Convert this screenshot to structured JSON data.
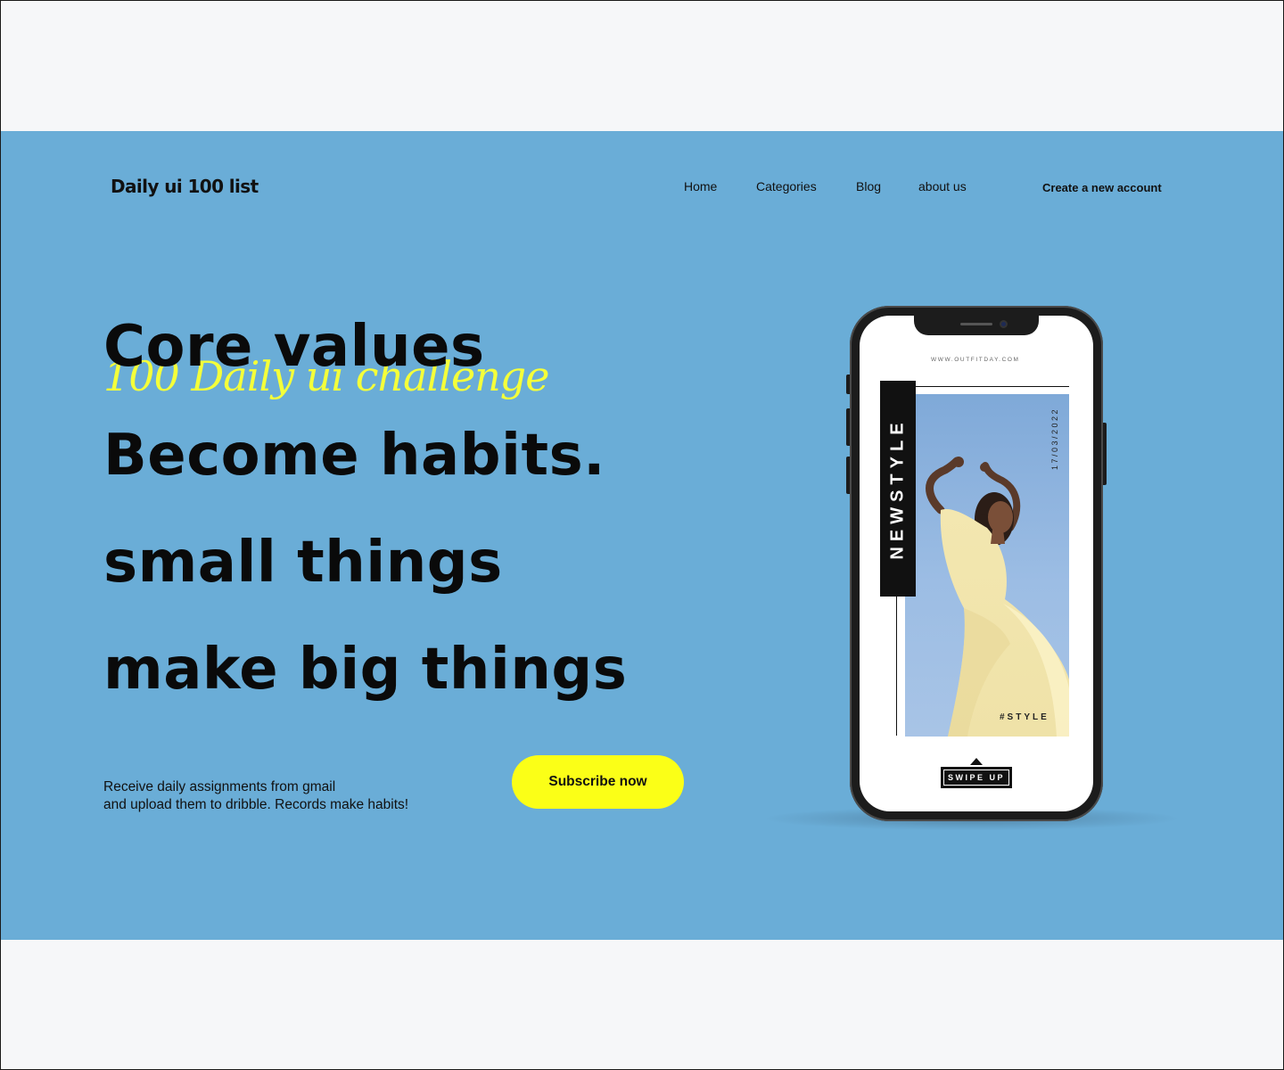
{
  "header": {
    "logo": "Daily ui 100 list",
    "nav": {
      "home": "Home",
      "categories": "Categories",
      "blog": "Blog",
      "about": "about us",
      "create_account": "Create a new account"
    }
  },
  "hero": {
    "line1": "Core values",
    "script": "100 Daily ui challenge",
    "line2": "Become habits.",
    "line3": "small things",
    "line4": "make big things",
    "description_line1": "Receive daily assignments from gmail",
    "description_line2": "and upload them to dribble. Records make habits!",
    "cta": "Subscribe now"
  },
  "phone_screen": {
    "url": "WWW.OUTFITDAY.COM",
    "newstyle": "NEWSTYLE",
    "date": "17/03/2022",
    "hashtag": "#STYLE",
    "swipe": "SWIPE UP"
  },
  "colors": {
    "hero_bg": "#6aadd7",
    "accent_yellow": "#fbff17",
    "script_yellow": "#f4ff3a",
    "text_dark": "#0a0a0a",
    "page_bg": "#f6f7f9"
  }
}
